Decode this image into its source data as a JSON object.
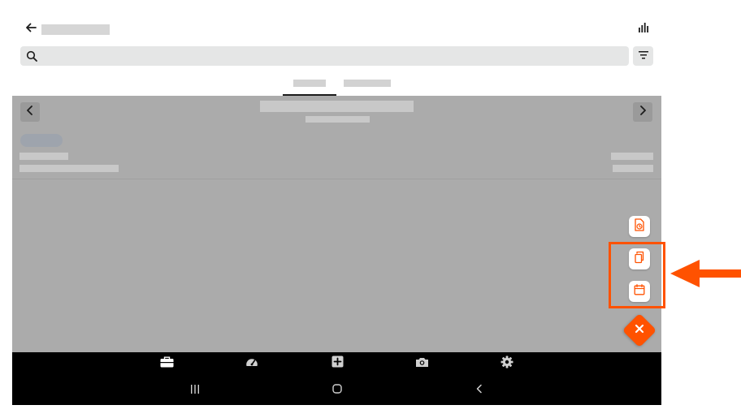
{
  "header": {
    "back_icon": "arrow-left-icon",
    "chart_icon": "bar-chart-icon"
  },
  "search": {
    "icon": "search-icon",
    "placeholder": "",
    "value": "",
    "filter_icon": "filter-icon"
  },
  "tabs": [
    {
      "id": "tab-1",
      "active": true
    },
    {
      "id": "tab-2",
      "active": false
    }
  ],
  "content": {
    "prev_icon": "chevron-left-icon",
    "next_icon": "chevron-right-icon"
  },
  "fab": {
    "actions": [
      {
        "icon": "document-clock-icon"
      },
      {
        "icon": "copy-icon"
      },
      {
        "icon": "calendar-icon"
      }
    ],
    "main_icon": "close-icon",
    "color": "#ff5200"
  },
  "bottom_nav": {
    "items": [
      {
        "icon": "briefcase-icon"
      },
      {
        "icon": "speedometer-icon"
      },
      {
        "icon": "plus-square-icon"
      },
      {
        "icon": "camera-icon"
      },
      {
        "icon": "gear-icon"
      }
    ]
  },
  "system_nav": {
    "items": [
      {
        "icon": "recent-apps-icon"
      },
      {
        "icon": "home-icon"
      },
      {
        "icon": "back-chevron-icon"
      }
    ]
  },
  "annotation": {
    "color": "#ff5200",
    "arrow_icon": "arrow-left-icon"
  }
}
